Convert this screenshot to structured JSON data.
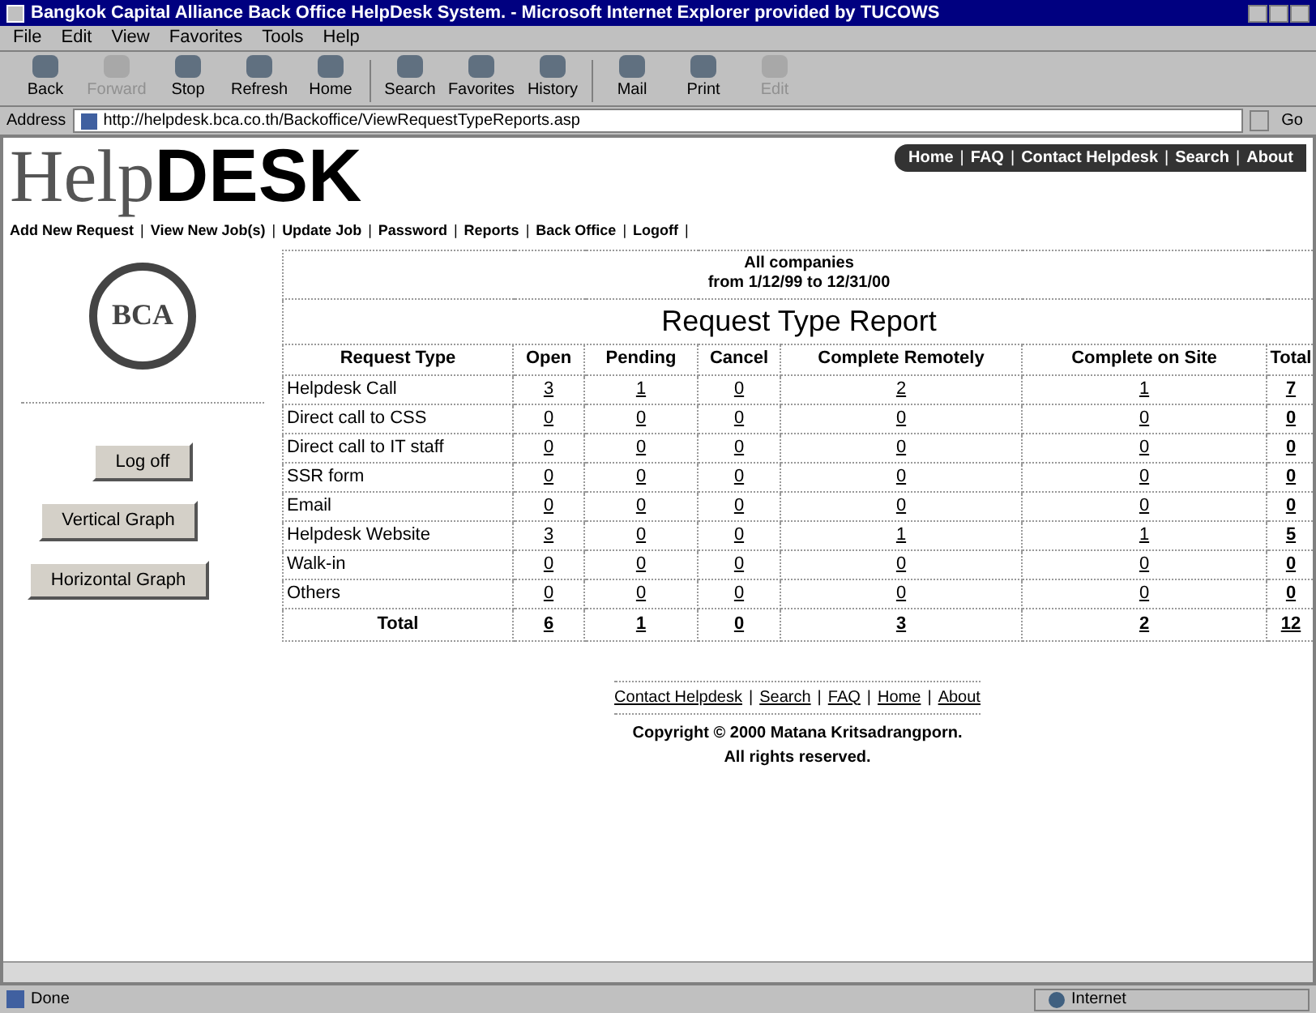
{
  "window": {
    "title": "Bangkok Capital Alliance Back Office HelpDesk System. - Microsoft Internet Explorer provided by TUCOWS"
  },
  "menu": [
    "File",
    "Edit",
    "View",
    "Favorites",
    "Tools",
    "Help"
  ],
  "toolbar": [
    {
      "label": "Back",
      "disabled": false
    },
    {
      "label": "Forward",
      "disabled": true
    },
    {
      "label": "Stop",
      "disabled": false
    },
    {
      "label": "Refresh",
      "disabled": false
    },
    {
      "label": "Home",
      "disabled": false
    },
    {
      "label": "Search",
      "disabled": false
    },
    {
      "label": "Favorites",
      "disabled": false
    },
    {
      "label": "History",
      "disabled": false
    },
    {
      "label": "Mail",
      "disabled": false
    },
    {
      "label": "Print",
      "disabled": false
    },
    {
      "label": "Edit",
      "disabled": true
    }
  ],
  "address_bar": {
    "label": "Address",
    "value": "http://helpdesk.bca.co.th/Backoffice/ViewRequestTypeReports.asp",
    "go": "Go"
  },
  "page": {
    "logo": {
      "part_1": "Help",
      "part_2": "DESK"
    },
    "top_links": {
      "separator": "|",
      "items": [
        "Home",
        "FAQ",
        "Contact Helpdesk",
        "Search",
        "About"
      ]
    },
    "nav_links": {
      "separator": "|",
      "items": [
        "Add New Request",
        "View New Job(s)",
        "Update Job",
        "Password",
        "Reports",
        "Back Office",
        "Logoff"
      ]
    },
    "company_logo": "BCA",
    "sidebar_buttons": [
      "Log off",
      "Vertical Graph",
      "Horizontal Graph"
    ],
    "report": {
      "scope": "All companies",
      "period": "from 1/12/99 to 12/31/00",
      "title": "Request Type Report",
      "columns": [
        "Request Type",
        "Open",
        "Pending",
        "Cancel",
        "Complete Remotely",
        "Complete on Site",
        "Total"
      ],
      "rows": [
        {
          "type": "Helpdesk Call",
          "values": [
            "3",
            "1",
            "0",
            "2",
            "1",
            "7"
          ]
        },
        {
          "type": "Direct call to CSS",
          "values": [
            "0",
            "0",
            "0",
            "0",
            "0",
            "0"
          ]
        },
        {
          "type": "Direct call to IT staff",
          "values": [
            "0",
            "0",
            "0",
            "0",
            "0",
            "0"
          ]
        },
        {
          "type": "SSR form",
          "values": [
            "0",
            "0",
            "0",
            "0",
            "0",
            "0"
          ]
        },
        {
          "type": "Email",
          "values": [
            "0",
            "0",
            "0",
            "0",
            "0",
            "0"
          ]
        },
        {
          "type": "Helpdesk Website",
          "values": [
            "3",
            "0",
            "0",
            "1",
            "1",
            "5"
          ]
        },
        {
          "type": "Walk-in",
          "values": [
            "0",
            "0",
            "0",
            "0",
            "0",
            "0"
          ]
        },
        {
          "type": "Others",
          "values": [
            "0",
            "0",
            "0",
            "0",
            "0",
            "0"
          ]
        }
      ],
      "total": {
        "label": "Total",
        "values": [
          "6",
          "1",
          "0",
          "3",
          "2",
          "12"
        ]
      }
    },
    "footer_links": {
      "separator": "|",
      "items": [
        "Contact Helpdesk",
        "Search",
        "FAQ",
        "Home",
        "About"
      ]
    },
    "copyright": "Copyright © 2000 Matana Kritsadrangporn.",
    "rights": "All rights reserved."
  },
  "status_bar": {
    "text": "Done",
    "zone": "Internet"
  }
}
